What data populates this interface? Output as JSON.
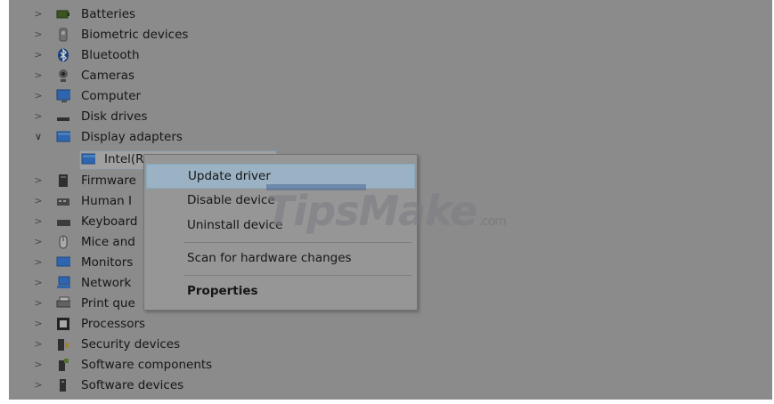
{
  "tree": {
    "items": [
      {
        "label": "Batteries",
        "icon": "battery-icon",
        "expanded": false
      },
      {
        "label": "Biometric devices",
        "icon": "biometric-icon",
        "expanded": false
      },
      {
        "label": "Bluetooth",
        "icon": "bluetooth-icon",
        "expanded": false
      },
      {
        "label": "Cameras",
        "icon": "camera-icon",
        "expanded": false
      },
      {
        "label": "Computer",
        "icon": "computer-icon",
        "expanded": false
      },
      {
        "label": "Disk drives",
        "icon": "disk-drive-icon",
        "expanded": false
      },
      {
        "label": "Display adapters",
        "icon": "display-adapter-icon",
        "expanded": true
      },
      {
        "label": "Firmware",
        "icon": "firmware-icon",
        "expanded": false
      },
      {
        "label": "Human I",
        "icon": "human-interface-icon",
        "expanded": false
      },
      {
        "label": "Keyboard",
        "icon": "keyboard-icon",
        "expanded": false
      },
      {
        "label": "Mice and",
        "icon": "mouse-icon",
        "expanded": false
      },
      {
        "label": "Monitors",
        "icon": "monitor-icon",
        "expanded": false
      },
      {
        "label": "Network",
        "icon": "network-icon",
        "expanded": false
      },
      {
        "label": "Print que",
        "icon": "printer-icon",
        "expanded": false
      },
      {
        "label": "Processors",
        "icon": "processor-icon",
        "expanded": false
      },
      {
        "label": "Security devices",
        "icon": "security-icon",
        "expanded": false
      },
      {
        "label": "Software components",
        "icon": "software-component-icon",
        "expanded": false
      },
      {
        "label": "Software devices",
        "icon": "software-device-icon",
        "expanded": false
      }
    ],
    "child": {
      "label": "Intel(R) UHD Graphics 620",
      "icon": "display-adapter-icon",
      "selected": true
    }
  },
  "context_menu": {
    "items": [
      {
        "label": "Update driver",
        "highlighted": true
      },
      {
        "label": "Disable device"
      },
      {
        "label": "Uninstall device"
      },
      {
        "label": "Scan for hardware changes"
      },
      {
        "label": "Properties",
        "bold": true
      }
    ]
  },
  "watermark": {
    "text_main": "TipsMake",
    "text_suffix": ".com"
  },
  "colors": {
    "background": "#aaaaaa",
    "highlight": "#bcd9ee",
    "accent_blue": "#3a7bd5"
  }
}
